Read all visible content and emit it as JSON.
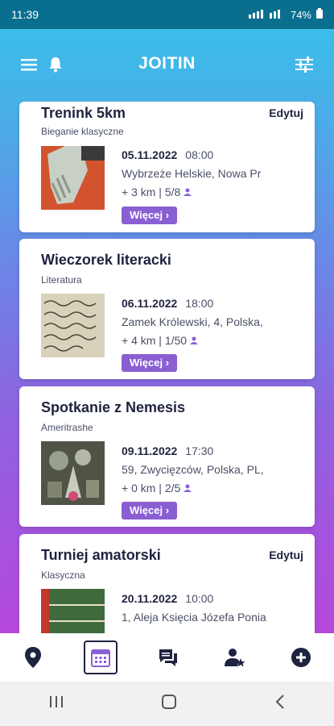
{
  "status": {
    "time": "11:39",
    "battery": "74%"
  },
  "app": {
    "title": "JOITIN"
  },
  "events": [
    {
      "title": "Trenink 5km",
      "category": "Bieganie klasyczne",
      "edit": "Edytuj",
      "date": "05.11.2022",
      "time": "08:00",
      "address": "Wybrzeże Helskie, Nowa Pr",
      "distance": "+ 3 km",
      "participants": "5/8",
      "more": "Więcej"
    },
    {
      "title": "Wieczorek literacki",
      "category": "Literatura",
      "edit": "",
      "date": "06.11.2022",
      "time": "18:00",
      "address": "Zamek Królewski, 4, Polska,",
      "distance": "+ 4 km",
      "participants": "1/50",
      "more": "Więcej"
    },
    {
      "title": "Spotkanie z Nemesis",
      "category": "Ameritrashe",
      "edit": "",
      "date": "09.11.2022",
      "time": "17:30",
      "address": "59, Zwycięzców, Polska, PL,",
      "distance": "+ 0 km",
      "participants": "2/5",
      "more": "Więcej"
    },
    {
      "title": "Turniej amatorski",
      "category": "Klasyczna",
      "edit": "Edytuj",
      "date": "20.11.2022",
      "time": "10:00",
      "address": "1, Aleja Księcia Józefa Ponia",
      "distance": "",
      "participants": "",
      "more": ""
    }
  ],
  "icons": {
    "menu": "menu-icon",
    "bell": "bell-icon",
    "filter": "filter-icon",
    "map": "map-pin-icon",
    "calendar": "calendar-icon",
    "chat": "chat-icon",
    "people": "user-star-icon",
    "add": "add-icon"
  },
  "colors": {
    "accent": "#8a5fd2",
    "topbar": "#0a6f8f"
  }
}
